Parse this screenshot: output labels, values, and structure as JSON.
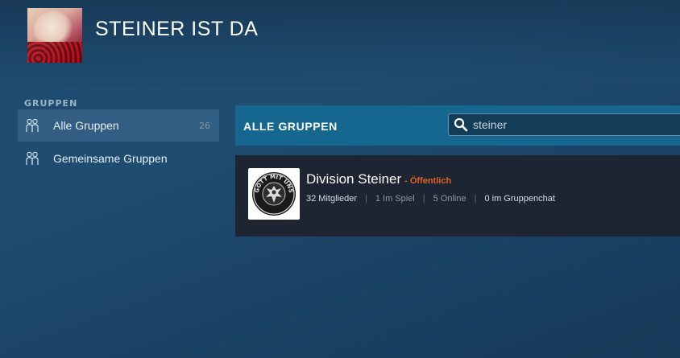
{
  "profile": {
    "name": "STEINER IST DA"
  },
  "sidebar": {
    "header": "GRUPPEN",
    "items": [
      {
        "label": "Alle Gruppen",
        "count": "26",
        "icon": "groups-icon",
        "active": true
      },
      {
        "label": "Gemeinsame Gruppen",
        "icon": "groups-icon",
        "active": false
      }
    ]
  },
  "main": {
    "section_title": "ALLE GRUPPEN",
    "search": {
      "value": "steiner",
      "icon": "search-icon"
    },
    "results": [
      {
        "name": "Division Steiner",
        "type": "- Öffentlich",
        "members": "32 Mitglieder",
        "in_game": "1 Im Spiel",
        "online": "5 Online",
        "in_chat": "0 im Gruppenchat",
        "seal_text": "GOTT MIT UNS"
      }
    ]
  },
  "colors": {
    "accent_bar": "#16678f",
    "public_label": "#e0602a",
    "panel": "#1c2531"
  }
}
